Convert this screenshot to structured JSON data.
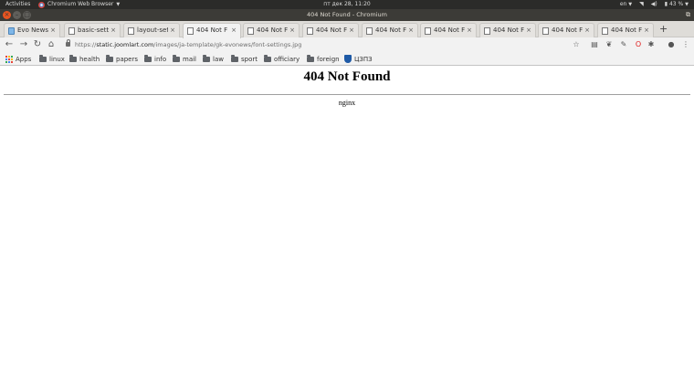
{
  "topbar": {
    "activities": "Activities",
    "app_name": "Chromium Web Browser",
    "clock": "пт дек 28, 11:20",
    "language": "en",
    "battery": "43 %"
  },
  "window": {
    "title": "404 Not Found - Chromium"
  },
  "tabs": [
    {
      "label": "Evo News",
      "icon": "evo-favicon"
    },
    {
      "label": "basic-setti",
      "icon": "page-icon"
    },
    {
      "label": "layout-set",
      "icon": "page-icon"
    },
    {
      "label": "404 Not F",
      "icon": "page-icon",
      "active": true
    },
    {
      "label": "404 Not F",
      "icon": "page-icon"
    },
    {
      "label": "404 Not F",
      "icon": "page-icon"
    },
    {
      "label": "404 Not F",
      "icon": "page-icon"
    },
    {
      "label": "404 Not F",
      "icon": "page-icon"
    },
    {
      "label": "404 Not F",
      "icon": "page-icon"
    },
    {
      "label": "404 Not F",
      "icon": "page-icon"
    },
    {
      "label": "404 Not F",
      "icon": "page-icon"
    }
  ],
  "omnibox": {
    "scheme": "https://",
    "host": "static.joomlart.com",
    "path": "/images/ja-template/gk-evonews/font-settings.jpg"
  },
  "bookmarks": [
    {
      "label": "Apps",
      "icon": "apps-icon"
    },
    {
      "label": "linux",
      "icon": "folder-icon"
    },
    {
      "label": "health",
      "icon": "folder-icon"
    },
    {
      "label": "papers",
      "icon": "folder-icon"
    },
    {
      "label": "info",
      "icon": "folder-icon"
    },
    {
      "label": "mail",
      "icon": "folder-icon"
    },
    {
      "label": "law",
      "icon": "folder-icon"
    },
    {
      "label": "sport",
      "icon": "folder-icon"
    },
    {
      "label": "officiary",
      "icon": "folder-icon"
    },
    {
      "label": "foreign",
      "icon": "folder-icon"
    },
    {
      "label": "ЦЗПЗ",
      "icon": "shield-icon"
    }
  ],
  "page": {
    "heading": "404 Not Found",
    "server": "nginx"
  },
  "colors": {
    "topbar": "#2b2b29",
    "titlebar": "#3c3b37",
    "close_button": "#e95420",
    "toolbar": "#f2f2f2"
  }
}
